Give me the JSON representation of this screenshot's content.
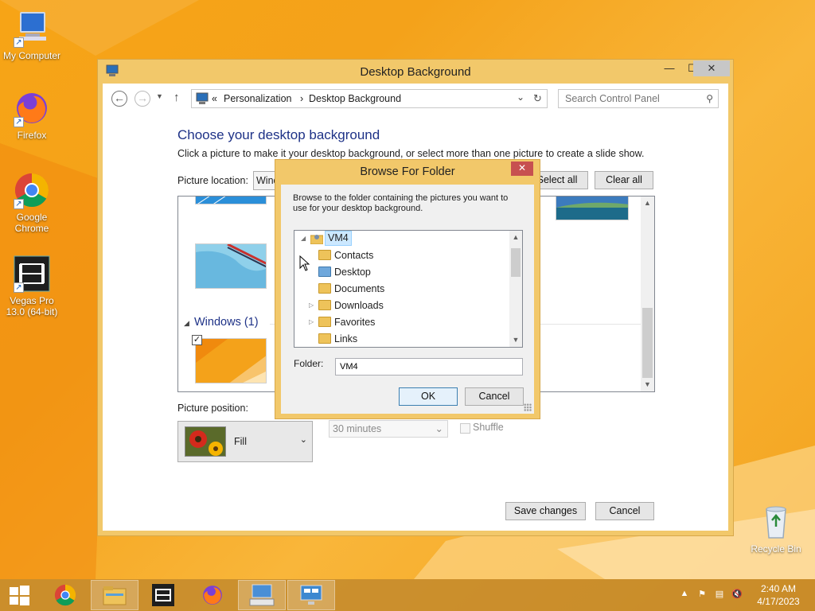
{
  "desktop": {
    "icons": [
      {
        "label": "My Computer"
      },
      {
        "label": "Firefox"
      },
      {
        "label": "Google Chrome"
      },
      {
        "label": "Vegas Pro 13.0 (64-bit)"
      },
      {
        "label": "Recycle Bin"
      }
    ]
  },
  "window": {
    "title": "Desktop Background",
    "caption": {
      "minimize": "—",
      "maximize": "☐",
      "close": "✕"
    },
    "address": {
      "prefix": "«",
      "crumbs": [
        "Personalization",
        "Desktop Background"
      ],
      "separator": "›"
    },
    "search": {
      "placeholder": "Search Control Panel"
    },
    "heading": "Choose your desktop background",
    "description": "Click a picture to make it your desktop background, or select more than one picture to create a slide show.",
    "picture_location_label": "Picture location:",
    "picture_location_value": "Wind",
    "select_all": "Select all",
    "clear_all": "Clear all",
    "group_title": "Windows (1)",
    "picture_position_label": "Picture position:",
    "picture_position_value": "Fill",
    "interval_value": "30 minutes",
    "shuffle_label": "Shuffle",
    "save_changes": "Save changes",
    "cancel": "Cancel"
  },
  "dialog": {
    "title": "Browse For Folder",
    "close": "✕",
    "instructions": "Browse to the folder containing the pictures you want to use for your desktop background.",
    "tree": [
      {
        "label": "VM4",
        "expander": "◢",
        "selected": true
      },
      {
        "label": "Contacts",
        "expander": ""
      },
      {
        "label": "Desktop",
        "expander": ""
      },
      {
        "label": "Documents",
        "expander": ""
      },
      {
        "label": "Downloads",
        "expander": "▷"
      },
      {
        "label": "Favorites",
        "expander": "▷"
      },
      {
        "label": "Links",
        "expander": ""
      }
    ],
    "folder_label": "Folder:",
    "folder_value": "VM4",
    "ok": "OK",
    "cancel": "Cancel"
  },
  "taskbar": {
    "apps": [
      "Start",
      "Google Chrome",
      "File Explorer",
      "Vegas Pro",
      "Firefox",
      "Control Panel",
      "Display Settings"
    ],
    "time": "2:40 AM",
    "date": "4/17/2023"
  },
  "colors": {
    "accent": "#f2c86a",
    "heading": "#1e3287",
    "wallpaper": "#f7a416"
  }
}
